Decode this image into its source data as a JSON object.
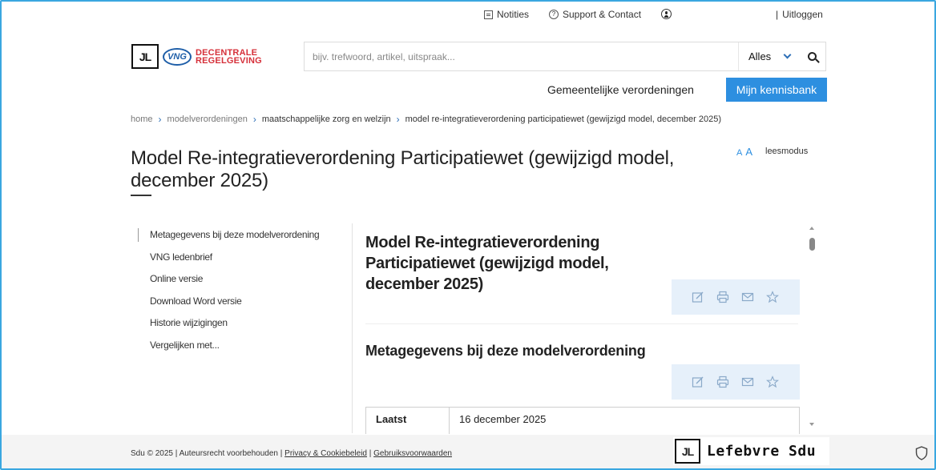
{
  "topbar": {
    "notities": "Notities",
    "support": "Support & Contact",
    "separator": "|",
    "uitloggen": "Uitloggen"
  },
  "logo": {
    "jl": "JL",
    "vng": "VNG",
    "line1": "DECENTRALE",
    "line2": "REGELGEVING"
  },
  "search": {
    "placeholder": "bijv. trefwoord, artikel, uitspraak...",
    "scope_selected": "Alles"
  },
  "nav": {
    "gemeentelijke": "Gemeentelijke verordeningen",
    "mijn": "Mijn kennisbank"
  },
  "breadcrumb": [
    "home",
    "modelverordeningen",
    "maatschappelijke zorg en welzijn",
    "model re-integratieverordening participatiewet (gewijzigd model, december 2025)"
  ],
  "page": {
    "title": "Model Re-integratieverordening Participatiewet (gewijzigd model, december 2025)",
    "aa_small": "A",
    "aa_big": "A",
    "leesmodus": "leesmodus"
  },
  "sidebar": [
    "Metagegevens bij deze modelverordening",
    "VNG ledenbrief",
    "Online versie",
    "Download Word versie",
    "Historie wijzigingen",
    "Vergelijken met..."
  ],
  "document": {
    "title": "Model Re-integratieverordening Participatiewet (gewijzigd model, december 2025)",
    "section_heading": "Metagegevens bij deze modelverordening",
    "meta": [
      {
        "key": "Laatst",
        "value": "16 december 2025"
      }
    ]
  },
  "footer": {
    "copyright": "Sdu © 2025 | Auteursrecht voorbehouden |",
    "privacy": "Privacy & Cookiebeleid",
    "sep": "|",
    "voorwaarden": "Gebruiksvoorwaarden",
    "brand_jl": "JL",
    "brand": "Lefebvre Sdu"
  },
  "colors": {
    "accent": "#2d8fe0",
    "brand_red": "#d6303a",
    "vng_blue": "#1e5ea8",
    "action_bar": "#e6f0fa"
  }
}
